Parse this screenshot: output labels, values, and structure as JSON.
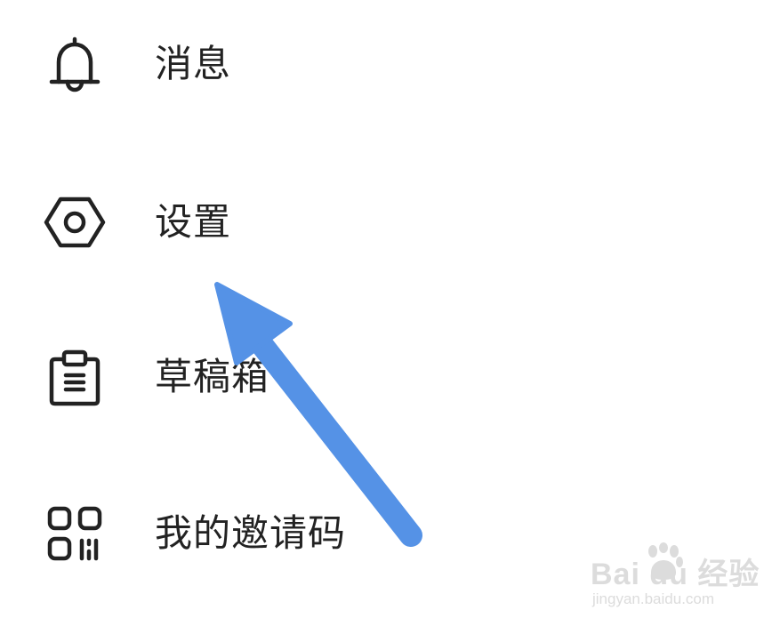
{
  "menu": {
    "items": [
      {
        "label": "消息",
        "icon": "bell-icon"
      },
      {
        "label": "设置",
        "icon": "hexagon-settings-icon"
      },
      {
        "label": "草稿箱",
        "icon": "clipboard-icon"
      },
      {
        "label": "我的邀请码",
        "icon": "qr-code-icon"
      }
    ]
  },
  "annotation": {
    "arrow_color": "#5592e6",
    "points_to": "设置"
  },
  "watermark": {
    "brand": "Bai du 经验",
    "url": "jingyan.baidu.com"
  },
  "colors": {
    "text": "#222222",
    "icon_stroke": "#222222",
    "background": "#ffffff"
  }
}
